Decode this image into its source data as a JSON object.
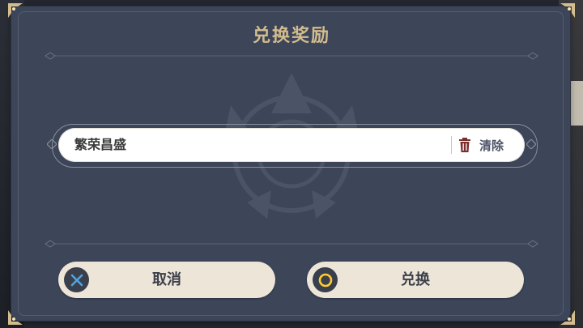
{
  "dialog": {
    "title": "兑换奖励"
  },
  "redeem_input": {
    "value": "繁荣昌盛",
    "clear_label": "清除"
  },
  "buttons": {
    "cancel_label": "取消",
    "confirm_label": "兑换"
  },
  "colors": {
    "panel": "#3d4559",
    "title_gold": "#d3bc8e",
    "button_bg": "#ece5d8",
    "cancel_icon": "#4fa3e3",
    "confirm_icon": "#ffcc33",
    "trash_icon": "#7a2e2e"
  },
  "icons": {
    "cancel": "cross-icon",
    "confirm": "circle-icon",
    "clear": "trash-icon"
  }
}
